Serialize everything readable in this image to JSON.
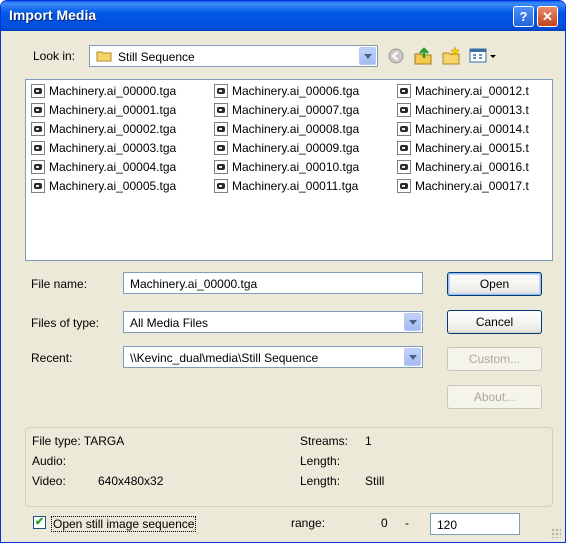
{
  "window": {
    "title": "Import Media",
    "help_label": "?",
    "close_label": "✕"
  },
  "look_in": {
    "label": "Look in:",
    "value": "Still Sequence"
  },
  "toolbar": {
    "icons": [
      "back-icon",
      "up-folder-icon",
      "new-folder-icon",
      "view-menu-icon"
    ]
  },
  "files": {
    "col1": [
      "Machinery.ai_00000.tga",
      "Machinery.ai_00001.tga",
      "Machinery.ai_00002.tga",
      "Machinery.ai_00003.tga",
      "Machinery.ai_00004.tga",
      "Machinery.ai_00005.tga"
    ],
    "col2": [
      "Machinery.ai_00006.tga",
      "Machinery.ai_00007.tga",
      "Machinery.ai_00008.tga",
      "Machinery.ai_00009.tga",
      "Machinery.ai_00010.tga",
      "Machinery.ai_00011.tga"
    ],
    "col3": [
      "Machinery.ai_00012.t",
      "Machinery.ai_00013.t",
      "Machinery.ai_00014.t",
      "Machinery.ai_00015.t",
      "Machinery.ai_00016.t",
      "Machinery.ai_00017.t"
    ]
  },
  "form": {
    "file_name_label": "File name:",
    "file_name_value": "Machinery.ai_00000.tga",
    "files_of_type_label": "Files of type:",
    "files_of_type_value": "All Media Files",
    "recent_label": "Recent:",
    "recent_value": "\\\\Kevinc_dual\\media\\Still Sequence"
  },
  "buttons": {
    "open": "Open",
    "cancel": "Cancel",
    "custom": "Custom...",
    "about": "About..."
  },
  "info": {
    "file_type": "File type: TARGA",
    "audio": "Audio:",
    "video_label": "Video:",
    "video_value": "640x480x32",
    "streams_label": "Streams:",
    "streams_value": "1",
    "length1_label": "Length:",
    "length2_label": "Length:",
    "length2_value": "Still"
  },
  "sequence": {
    "checked": true,
    "label": "Open still image sequence",
    "range_label": "range:",
    "range_start": "0",
    "range_dash": "-",
    "range_end": "120"
  }
}
